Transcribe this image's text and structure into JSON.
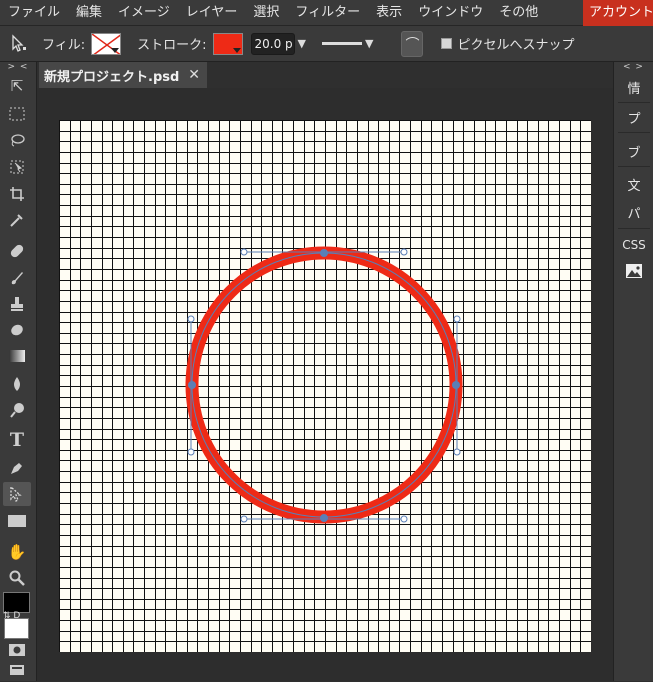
{
  "menubar": {
    "items": [
      "ファイル",
      "編集",
      "イメージ",
      "レイヤー",
      "選択",
      "フィルター",
      "表示",
      "ウインドウ",
      "その他"
    ],
    "account": "アカウント"
  },
  "options": {
    "fill_label": "フィル:",
    "stroke_label": "ストローク:",
    "stroke_width": "20.0 p",
    "snap_label": "ピクセルへスナップ",
    "stroke_color": "#ee2a16"
  },
  "document": {
    "tab_title": "新規プロジェクト.psd",
    "close_symbol": "✕"
  },
  "toolbar": {
    "collapse": "> <",
    "swap_label": "⇅ D"
  },
  "rightpanel": {
    "collapse": "< >",
    "items": [
      "情",
      "プ",
      "ブ",
      "文",
      "パ",
      "CSS"
    ]
  },
  "colors": {
    "accent": "#c8301e",
    "foreground": "#000000",
    "background": "#ffffff"
  }
}
